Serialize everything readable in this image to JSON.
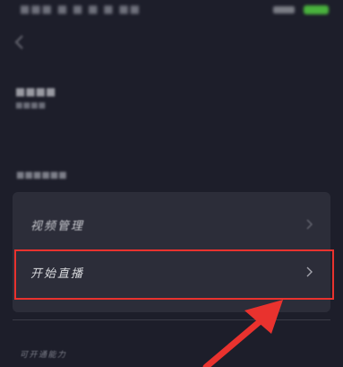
{
  "status_bar": {
    "left_text": "■■■ ■ ■ ■ ■ ■■",
    "icons": [
      "signal-icon",
      "battery-icon"
    ],
    "battery_color": "#49b23d"
  },
  "header": {
    "back_icon": "chevron-left-icon"
  },
  "profile": {
    "name": "■■■■",
    "sub": "■■■■"
  },
  "section": {
    "title": "■■■■■■"
  },
  "menu": {
    "items": [
      {
        "label": "视频管理",
        "icon": "chevron-right-icon"
      },
      {
        "label": "开始直播",
        "icon": "chevron-right-icon"
      }
    ]
  },
  "footer": {
    "label": "可开通能力"
  },
  "annotation": {
    "color": "#e9322e",
    "target": "开始直播"
  }
}
